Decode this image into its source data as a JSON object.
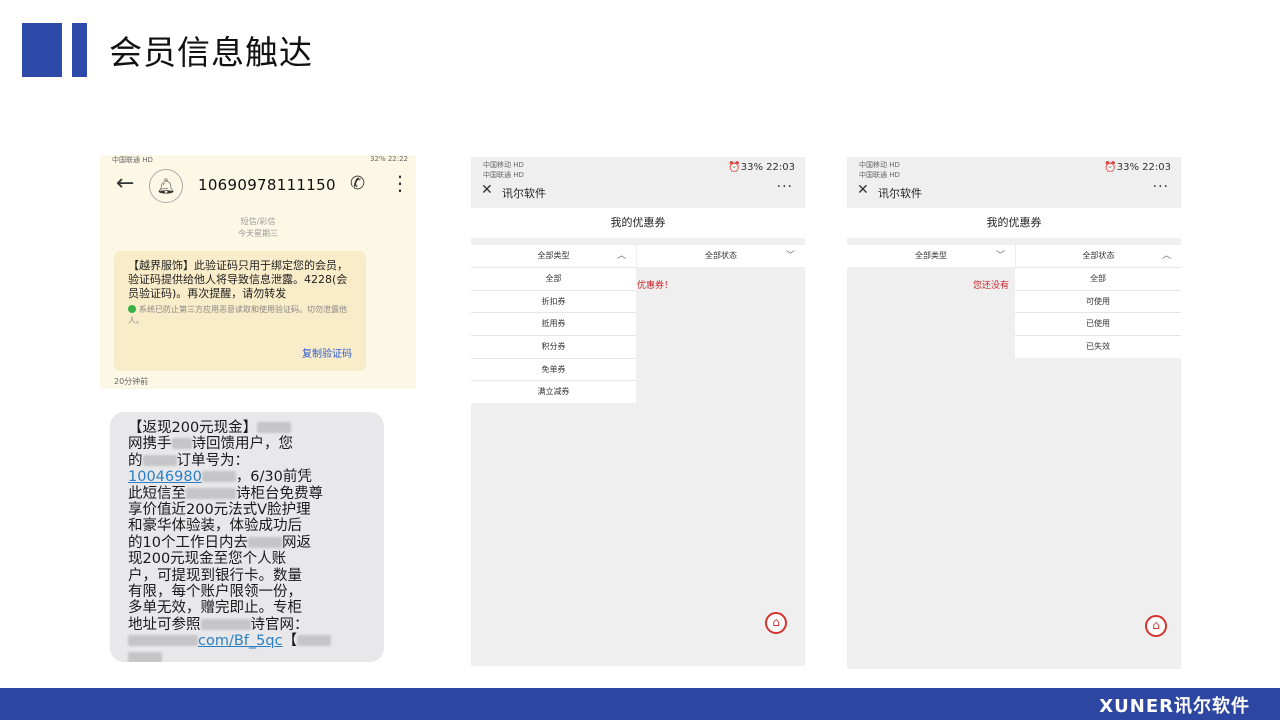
{
  "header": {
    "title": "会员信息触达"
  },
  "footer": {
    "brand": "XUNER讯尔软件"
  },
  "sms": {
    "status_left": "中国联通 HD",
    "status_right": "32%  22:22",
    "phone_number": "10690978111150",
    "meta_type": "短信/彩信",
    "meta_day": "今天星期三",
    "body": "【越界服饰】此验证码只用于绑定您的会员，验证码提供给他人将导致信息泄露。4228(会员验证码)。再次提醒，请勿转发",
    "warning": "系统已防止第三方应用恶意读取和使用验证码。切勿泄露他人。",
    "copy_label": "复制验证码",
    "time": "20分钟前"
  },
  "sms2": {
    "l1": "【返现200元现金】",
    "l2a": "网携手",
    "l2b": "诗回馈用户，您",
    "l3a": "的",
    "l3b": "订单号为：",
    "link1": "10046980",
    "l4b": "，6/30前凭",
    "l5a": "此短信至",
    "l5b": "诗柜台免费尊",
    "l6": "享价值近200元法式V脸护理",
    "l7": "和豪华体验装，体验成功后",
    "l8a": "的10个工作日内去",
    "l8b": "网返",
    "l9": "现200元现金至您个人账",
    "l10": "户，可提现到银行卡。数量",
    "l11": "有限，每个账户限领一份，",
    "l12": "多单无效，赠完即止。专柜",
    "l13a": "地址可参照",
    "l13b": "诗官网：",
    "link2": "com/Bf_5qc",
    "l14": "【"
  },
  "phone1": {
    "status_left1": "中国移动 HD",
    "status_left2": "中国联通 HD",
    "status_right": "⏰33%  22:03",
    "app_name": "讯尔软件",
    "page_title": "我的优惠券",
    "filter_type": "全部类型",
    "filter_status": "全部状态",
    "menu": [
      "全部",
      "折扣券",
      "抵用券",
      "积分券",
      "免单券",
      "满立减券"
    ],
    "empty_text": "优惠券！"
  },
  "phone2": {
    "status_left1": "中国移动 HD",
    "status_left2": "中国联通 HD",
    "status_right": "⏰33%  22:03",
    "app_name": "讯尔软件",
    "page_title": "我的优惠券",
    "filter_type": "全部类型",
    "filter_status": "全部状态",
    "menu": [
      "全部",
      "可使用",
      "已使用",
      "已失效"
    ],
    "empty_text": "您还没有"
  },
  "icons": {
    "back": "arrow-left-icon",
    "bell": "bell-icon",
    "call": "phone-icon",
    "more": "more-vertical-icon",
    "close": "close-icon",
    "dots": "more-horizontal-icon",
    "home": "home-icon"
  },
  "colors": {
    "accent": "#2e4aa8",
    "footer": "#2c46a1",
    "link": "#2a5bd7",
    "alert": "#c7262c"
  }
}
